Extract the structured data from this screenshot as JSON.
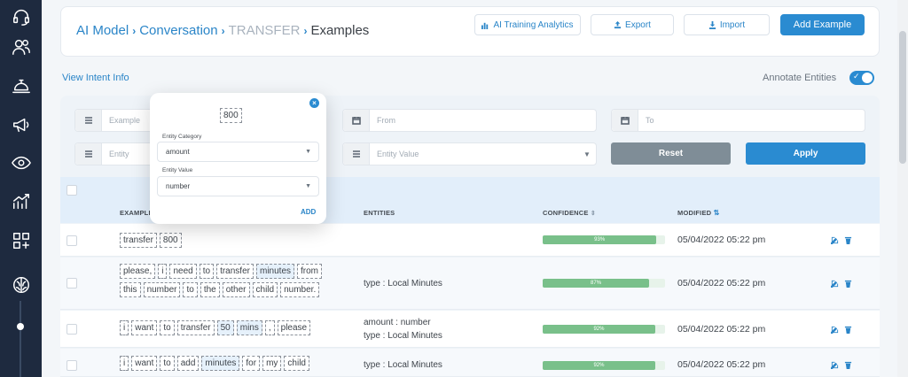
{
  "sidebar": {
    "icons": [
      "headset-icon",
      "users-icon",
      "service-bell-icon",
      "megaphone-icon",
      "eye-icon",
      "trend-chart-icon",
      "widgets-add-icon",
      "brain-icon"
    ]
  },
  "breadcrumb": {
    "items": [
      "AI Model",
      "Conversation",
      "TRANSFER",
      "Examples"
    ]
  },
  "header_buttons": {
    "analytics": "AI Training Analytics",
    "export": "Export",
    "import": "Import",
    "add": "Add Example"
  },
  "view_intent": "View Intent Info",
  "annotate": {
    "label": "Annotate Entities",
    "on": true
  },
  "filters": {
    "example_placeholder": "Example",
    "entity_placeholder": "Entity",
    "from_placeholder": "From",
    "to_placeholder": "To",
    "entity_value_placeholder": "Entity Value",
    "reset": "Reset",
    "apply": "Apply"
  },
  "table": {
    "headers": {
      "example": "EXAMPLE",
      "entities": "ENTITIES",
      "confidence": "CONFIDENCE",
      "modified": "MODIFIED"
    },
    "rows": [
      {
        "tokens": [
          "transfer",
          "800"
        ],
        "entities": [],
        "confidence": "93%",
        "confidence_value": 0.93,
        "modified": "05/04/2022 05:22 pm"
      },
      {
        "tokens": [
          "please,",
          "i",
          "need",
          "to",
          "transfer",
          "minutes",
          "from",
          "this",
          "number",
          "to",
          "the",
          "other",
          "child",
          "number."
        ],
        "entities": [
          "type : Local Minutes"
        ],
        "confidence": "87%",
        "confidence_value": 0.87,
        "modified": "05/04/2022 05:22 pm"
      },
      {
        "tokens": [
          "i",
          "want",
          "to",
          "transfer",
          "50",
          "mins",
          ",",
          "please"
        ],
        "entities": [
          "amount : number",
          "type : Local Minutes"
        ],
        "confidence": "92%",
        "confidence_value": 0.92,
        "modified": "05/04/2022 05:22 pm"
      },
      {
        "tokens": [
          "i",
          "want",
          "to",
          "add",
          "minutes",
          "for",
          "my",
          "child"
        ],
        "entities": [
          "type : Local Minutes"
        ],
        "confidence": "92%",
        "confidence_value": 0.92,
        "modified": "05/04/2022 05:22 pm"
      }
    ]
  },
  "popup": {
    "token": "800",
    "category_label": "Entity Category",
    "category_value": "amount",
    "value_label": "Entity Value",
    "value_value": "number",
    "add": "ADD"
  },
  "colors": {
    "accent": "#2a8bd1",
    "sidebar": "#1e2a3f",
    "confidence": "#79c08a"
  }
}
